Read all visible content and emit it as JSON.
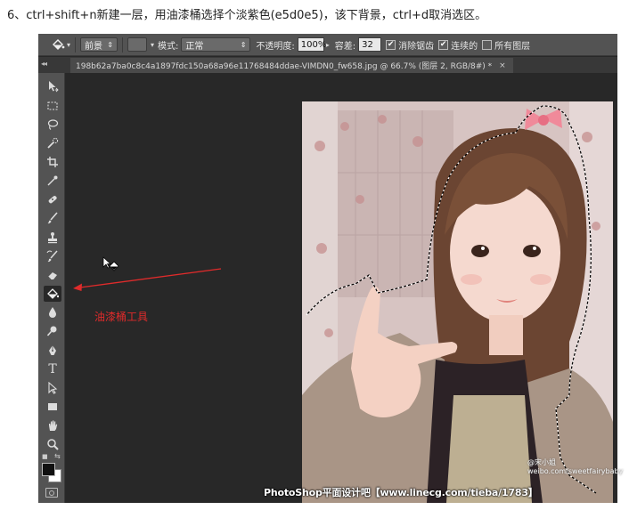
{
  "instruction": "6、ctrl+shift+n新建一层，用油漆桶选择个淡紫色(e5d0e5)，该下背景，ctrl+d取消选区。",
  "options_bar": {
    "fill_source": "前景",
    "mode_label": "模式:",
    "mode_value": "正常",
    "opacity_label": "不透明度:",
    "opacity_value": "100%",
    "tolerance_label": "容差:",
    "tolerance_value": "32",
    "antialias_label": "消除锯齿",
    "contiguous_label": "连续的",
    "all_layers_label": "所有图层"
  },
  "document_tab": {
    "title": "198b62a7ba0c8c4a1897fdc150a68a96e11768484ddae-VIMDN0_fw658.jpg @ 66.7% (图层 2, RGB/8#) *",
    "close": "×"
  },
  "toolbar": {
    "tools": [
      {
        "name": "move-tool"
      },
      {
        "name": "marquee-tool"
      },
      {
        "name": "lasso-tool"
      },
      {
        "name": "quick-selection-tool"
      },
      {
        "name": "crop-tool"
      },
      {
        "name": "eyedropper-tool"
      },
      {
        "name": "healing-brush-tool"
      },
      {
        "name": "brush-tool"
      },
      {
        "name": "clone-stamp-tool"
      },
      {
        "name": "history-brush-tool"
      },
      {
        "name": "eraser-tool"
      },
      {
        "name": "paint-bucket-tool"
      },
      {
        "name": "blur-tool"
      },
      {
        "name": "dodge-tool"
      },
      {
        "name": "pen-tool"
      },
      {
        "name": "type-tool"
      },
      {
        "name": "path-selection-tool"
      },
      {
        "name": "rectangle-tool"
      },
      {
        "name": "hand-tool"
      },
      {
        "name": "zoom-tool"
      }
    ],
    "type_glyph": "T",
    "active_tool": "paint-bucket-tool"
  },
  "annotation": {
    "label": "油漆桶工具",
    "color": "#e02b2b"
  },
  "colors": {
    "foreground": "#111111",
    "background": "#ffffff"
  },
  "watermark": "PhotoShop平面设计吧【www.linecg.com/tieba/1783】",
  "weibo_text": "@宋小姐\nweibo.com/sweetfairybaby"
}
